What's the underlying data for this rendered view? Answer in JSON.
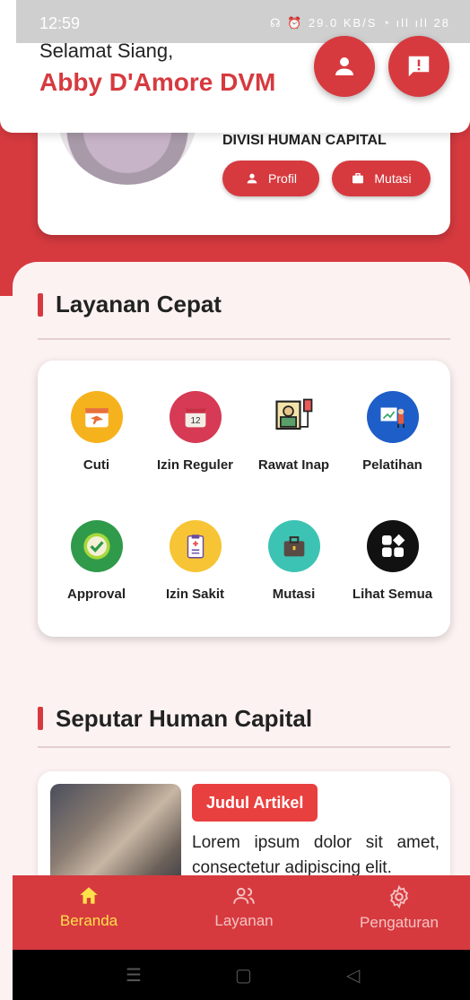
{
  "status_bar": {
    "time": "12:59",
    "icons_text": "☊ ⏰ 29.0 KB/S ◔ ıll ıll 28"
  },
  "header": {
    "greeting": "Selamat Siang,",
    "user_name": "Abby D'Amore DVM"
  },
  "profile": {
    "division": "DIVISI HUMAN CAPITAL",
    "profile_button": "Profil",
    "transfer_button": "Mutasi"
  },
  "quick_services": {
    "title": "Layanan Cepat",
    "items": [
      {
        "label": "Cuti",
        "icon": "calendar-plane-icon",
        "color": "#f6b21c"
      },
      {
        "label": "Izin Reguler",
        "icon": "calendar-12-icon",
        "color": "#d63a54"
      },
      {
        "label": "Rawat Inap",
        "icon": "hospital-bed-icon",
        "color": "#ffffff"
      },
      {
        "label": "Pelatihan",
        "icon": "training-board-icon",
        "color": "#1e5ec8"
      },
      {
        "label": "Approval",
        "icon": "approval-check-icon",
        "color": "#2f9a4a"
      },
      {
        "label": "Izin Sakit",
        "icon": "clipboard-medical-icon",
        "color": "#f6c434"
      },
      {
        "label": "Mutasi",
        "icon": "briefcase-icon",
        "color": "#3cc3b4"
      },
      {
        "label": "Lihat Semua",
        "icon": "grid-all-icon",
        "color": "#111111"
      }
    ]
  },
  "human_capital": {
    "title": "Seputar Human Capital",
    "article": {
      "tag": "Judul Artikel",
      "snippet": "Lorem ipsum dolor sit amet, consectetur adipiscing elit."
    }
  },
  "bottom_nav": {
    "home": "Beranda",
    "services": "Layanan",
    "settings": "Pengaturan",
    "active_color": "#ffe14a"
  }
}
